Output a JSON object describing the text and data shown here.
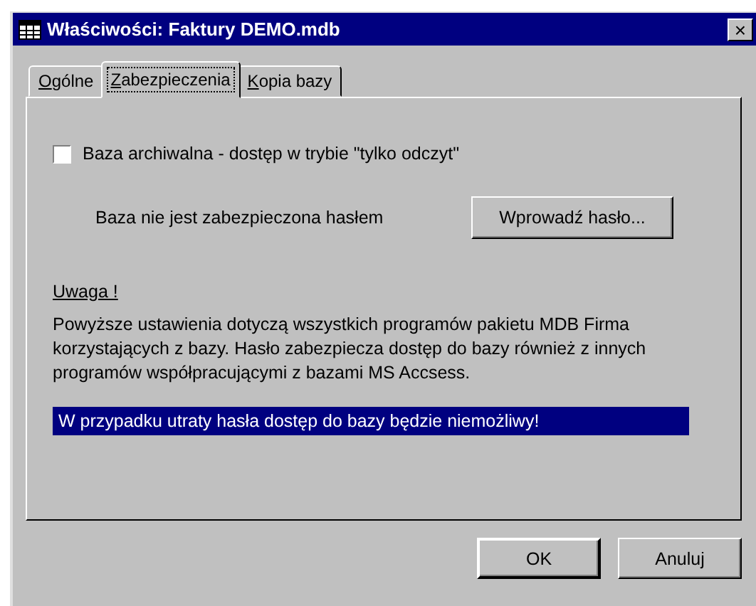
{
  "window": {
    "title": "Właściwości: Faktury DEMO.mdb",
    "close": "×"
  },
  "tabs": [
    {
      "label": "Ogólne",
      "selected": false
    },
    {
      "label": "Zabezpieczenia",
      "selected": true
    },
    {
      "label": "Kopia bazy",
      "selected": false
    }
  ],
  "archive": {
    "label": "Baza archiwalna - dostęp w trybie \"tylko odczyt\"",
    "checked": false
  },
  "password": {
    "status": "Baza nie jest zabezpieczona hasłem",
    "button": "Wprowadź hasło..."
  },
  "note": {
    "heading": "Uwaga !",
    "text": "Powyższe ustawienia dotyczą wszystkich programów pakietu MDB Firma korzystających z bazy. Hasło zabezpiecza dostęp do bazy również z innych programów współpracującymi z bazami MS Accsess.",
    "warning": "W przypadku utraty hasła dostęp do bazy będzie niemożliwy!"
  },
  "buttons": [
    {
      "label": "OK",
      "default": true
    },
    {
      "label": "Anuluj",
      "default": false
    }
  ]
}
